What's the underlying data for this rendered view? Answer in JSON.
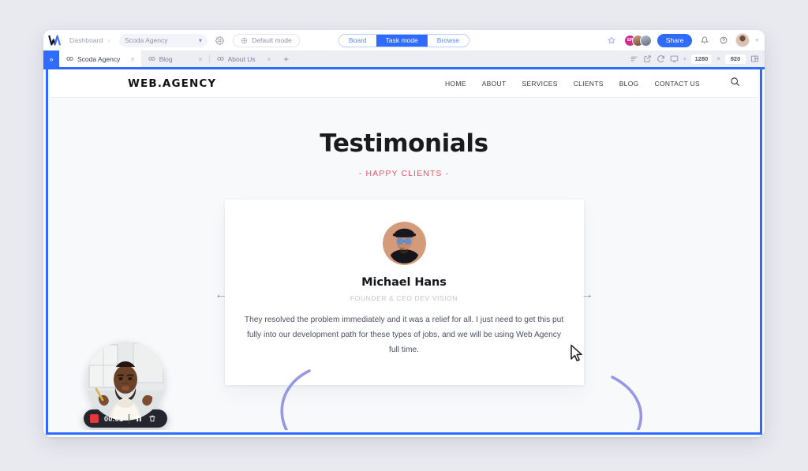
{
  "app": {
    "brand_icon": "w-logo-icon",
    "breadcrumb_root": "Dashboard",
    "breadcrumb_sep": "›",
    "project_name": "Scoda Agency",
    "settings_icon": "gear-icon",
    "mode_button": "Default mode",
    "mode_button_icon": "crosshair-icon",
    "segments": [
      {
        "label": "Board",
        "active": false
      },
      {
        "label": "Task mode",
        "active": true
      },
      {
        "label": "Browse",
        "active": false
      }
    ],
    "star_icon": "star-icon",
    "collaborators": [
      {
        "initials": "EP",
        "color": "#d42b8e"
      },
      {
        "initials": "",
        "color": "#8a6a52"
      },
      {
        "initials": "",
        "color": "#6a7a8c"
      }
    ],
    "share_label": "Share",
    "bell_icon": "bell-icon",
    "help_icon": "help-circle-icon",
    "profile_icon": "avatar",
    "profile_chevron": "chevron-down-icon"
  },
  "tabbar": {
    "sidebar_toggle_icon": "chevrons-right-icon",
    "tabs": [
      {
        "title": "Scoda Agency",
        "active": true,
        "icon": "link-icon",
        "close": "×"
      },
      {
        "title": "Blog",
        "active": false,
        "icon": "link-icon",
        "close": "×"
      },
      {
        "title": "About Us",
        "active": false,
        "icon": "link-icon",
        "close": "×"
      }
    ],
    "add_tab": "+",
    "tools": [
      {
        "icon": "list-lines-icon"
      },
      {
        "icon": "external-link-icon"
      },
      {
        "icon": "refresh-icon"
      },
      {
        "icon": "monitor-icon"
      }
    ],
    "viewport_width": "1280",
    "viewport_x": "×",
    "viewport_height": "920",
    "layout_icon": "panel-layout-icon"
  },
  "site": {
    "logo": "WEB.AGENCY",
    "nav": [
      "HOME",
      "ABOUT",
      "SERVICES",
      "CLIENTS",
      "BLOG",
      "CONTACT US"
    ],
    "search_icon": "search-icon",
    "heading": "Testimonials",
    "subheading": "- HAPPY CLIENTS -",
    "prev_arrow": "←",
    "next_arrow": "→",
    "testimonial": {
      "avatar": "portrait-man-hat-sunglasses",
      "name": "Michael Hans",
      "role": "FOUNDER & CEO DEV VISION",
      "quote": "They resolved the problem immediately and it was a relief for all. I just need to get this put fully into our development path for these types of jobs, and we will be using Web Agency full time."
    }
  },
  "annotation": {
    "shape": "hand-drawn-ellipse",
    "color": "#8a8ade"
  },
  "recorder": {
    "camera": "webcam-preview-person",
    "stop_icon": "stop-square-icon",
    "time": "00:01",
    "pause_icon": "pause-icon",
    "delete_icon": "trash-icon"
  },
  "colors": {
    "accent": "#2f6bff",
    "page_bg": "#e9eaf0",
    "site_bg": "#f8f9fb",
    "red": "#f0555f",
    "annotation_purple": "#8a8ade"
  }
}
